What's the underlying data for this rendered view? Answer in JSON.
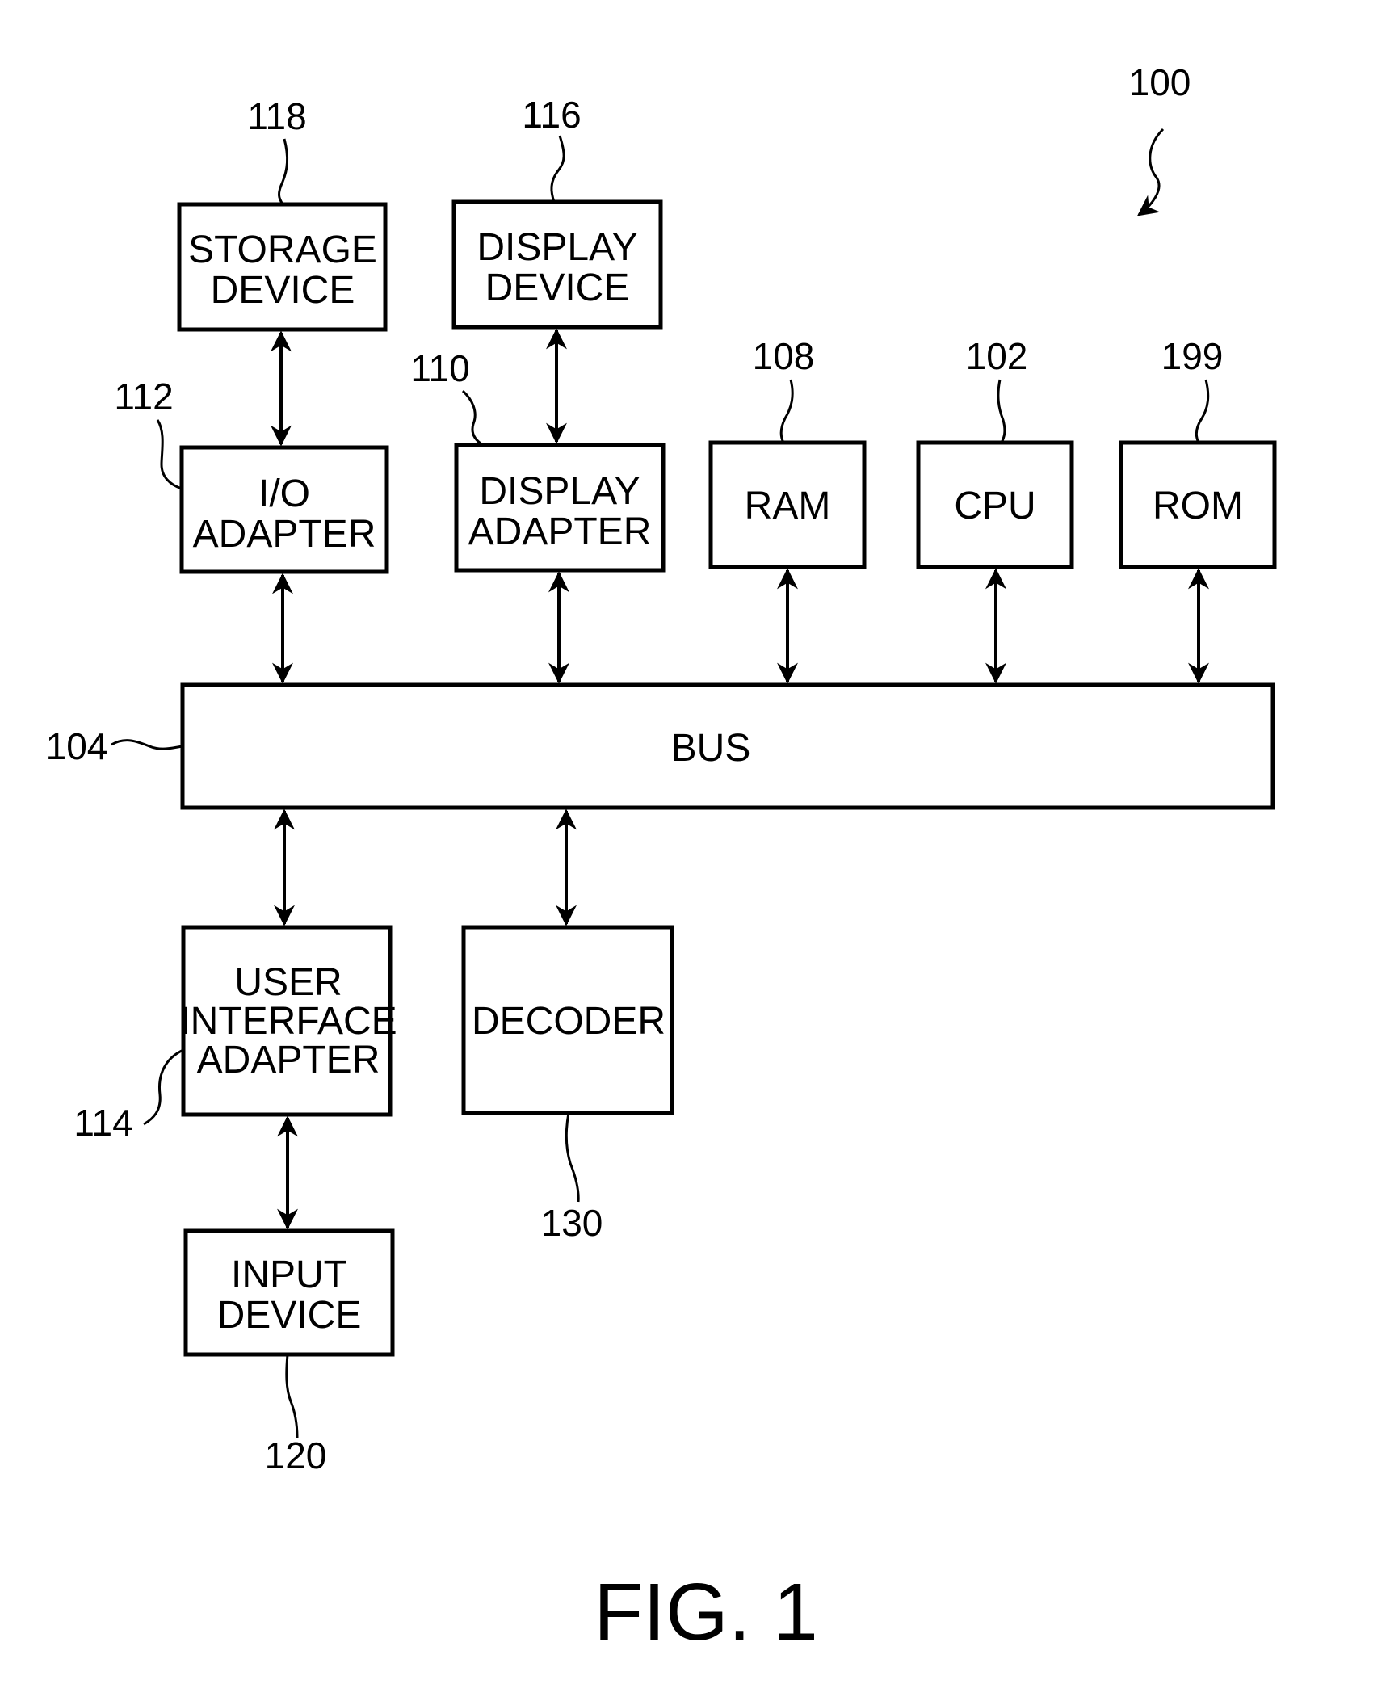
{
  "figure": {
    "title": "FIG. 1",
    "system_ref": "100"
  },
  "blocks": {
    "storage": {
      "lines": [
        "STORAGE",
        "DEVICE"
      ],
      "ref": "118"
    },
    "display_device": {
      "lines": [
        "DISPLAY",
        "DEVICE"
      ],
      "ref": "116"
    },
    "io_adapter": {
      "lines": [
        "I/O",
        "ADAPTER"
      ],
      "ref": "112"
    },
    "display_adapter": {
      "lines": [
        "DISPLAY",
        "ADAPTER"
      ],
      "ref": "110"
    },
    "ram": {
      "lines": [
        "RAM"
      ],
      "ref": "108"
    },
    "cpu": {
      "lines": [
        "CPU"
      ],
      "ref": "102"
    },
    "rom": {
      "lines": [
        "ROM"
      ],
      "ref": "199"
    },
    "bus": {
      "lines": [
        "BUS"
      ],
      "ref": "104"
    },
    "ui_adapter": {
      "lines": [
        "USER",
        "INTERFACE",
        "ADAPTER"
      ],
      "ref": "114"
    },
    "decoder": {
      "lines": [
        "DECODER"
      ],
      "ref": "130"
    },
    "input": {
      "lines": [
        "INPUT",
        "DEVICE"
      ],
      "ref": "120"
    }
  },
  "connections": [
    {
      "from": "storage",
      "to": "io_adapter",
      "type": "bidirectional"
    },
    {
      "from": "display_device",
      "to": "display_adapter",
      "type": "bidirectional"
    },
    {
      "from": "io_adapter",
      "to": "bus",
      "type": "bidirectional"
    },
    {
      "from": "display_adapter",
      "to": "bus",
      "type": "bidirectional"
    },
    {
      "from": "ram",
      "to": "bus",
      "type": "bidirectional"
    },
    {
      "from": "cpu",
      "to": "bus",
      "type": "bidirectional"
    },
    {
      "from": "rom",
      "to": "bus",
      "type": "bidirectional"
    },
    {
      "from": "bus",
      "to": "ui_adapter",
      "type": "bidirectional"
    },
    {
      "from": "bus",
      "to": "decoder",
      "type": "bidirectional"
    },
    {
      "from": "ui_adapter",
      "to": "input",
      "type": "bidirectional"
    }
  ]
}
